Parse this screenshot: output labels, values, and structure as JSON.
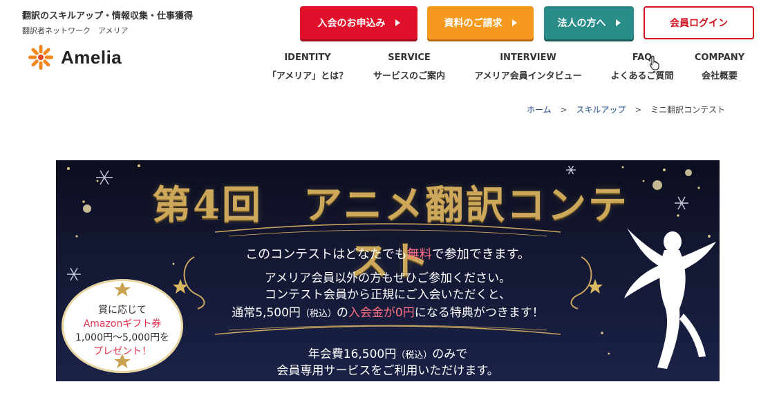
{
  "header": {
    "tagline": "翻訳のスキルアップ・情報収集・仕事獲得",
    "subtagline": "翻訳者ネットワーク　アメリア",
    "logo_text": "Amelia",
    "logo_icon": "sunburst-logo-icon"
  },
  "cta": {
    "join": "入会のお申込み",
    "docs": "資料のご請求",
    "corporate": "法人の方へ",
    "login": "会員ログイン"
  },
  "colors": {
    "join": "#e0102a",
    "docs": "#f59a1f",
    "corporate": "#2a8d8a",
    "login": "#d0111e",
    "breadcrumb_link": "#1e4a8a",
    "banner_gold": "#cda85a",
    "highlight_pink": "#ff6f86"
  },
  "nav": [
    {
      "en": "IDENTITY",
      "ja": "「アメリア」とは？"
    },
    {
      "en": "SERVICE",
      "ja": "サービスのご案内"
    },
    {
      "en": "INTERVIEW",
      "ja": "アメリア会員インタビュー"
    },
    {
      "en": "FAQ",
      "ja": "よくあるご質問"
    },
    {
      "en": "COMPANY",
      "ja": "会社概要"
    }
  ],
  "breadcrumb": {
    "home": "ホーム",
    "skillup": "スキルアップ",
    "current": "ミニ翻訳コンテスト",
    "separator": ">"
  },
  "banner": {
    "title": "第4回　アニメ翻訳コンテスト",
    "line1_pre": "このコンテストはどなたでも",
    "line1_em": "無料",
    "line1_post": "で参加できます。",
    "line2": "アメリア会員以外の方もぜひご参加ください。",
    "line3": "コンテスト会員から正規にご入会いただくと、",
    "line4_pre": "通常5,500円",
    "line4_tax": "（税込）",
    "line4_mid": "の",
    "line4_em": "入会金が0円",
    "line4_post": "になる特典がつきます！",
    "line5_pre": "年会費16,500円",
    "line5_tax": "（税込）",
    "line5_post": "のみで",
    "line6": "会員専用サービスをご利用いただけます。",
    "badge_line1": "賞に応じて",
    "badge_line2": "Amazonギフト券",
    "badge_line3": "1,000円～5,000円を",
    "badge_line4": "プレゼント！"
  }
}
